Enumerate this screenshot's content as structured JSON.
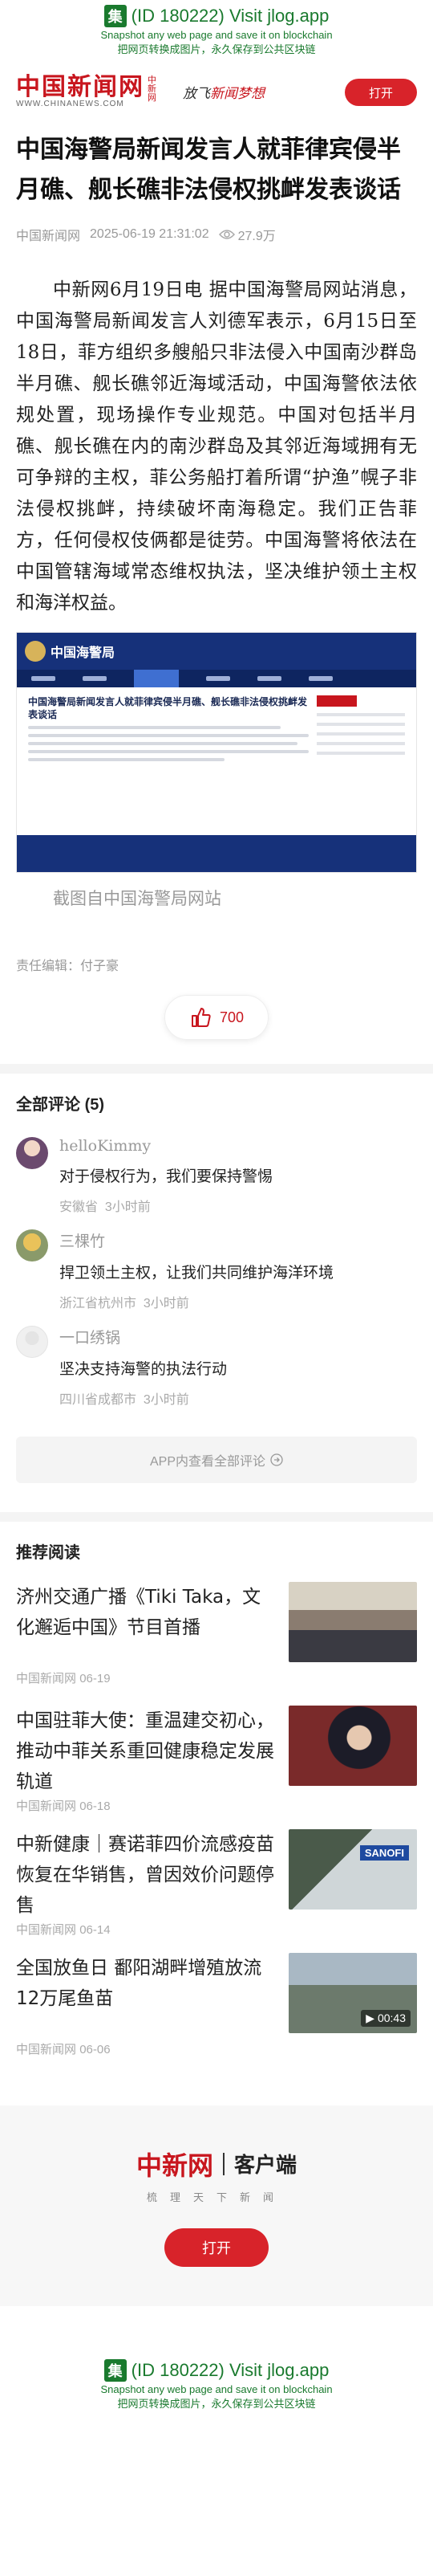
{
  "jlog": {
    "logo_char": "集",
    "title": "(ID 180222) Visit jlog.app",
    "sub1": "Snapshot any web page and save it on blockchain",
    "sub2": "把网页转换成图片，永久保存到公共区块链"
  },
  "header": {
    "brand_cn": "中国新闻网",
    "brand_en": "WWW.CHINANEWS.COM",
    "brand_side": "中新网",
    "slogan_a": "放飞",
    "slogan_b": "新闻",
    "slogan_c": "梦想",
    "open_label": "打开"
  },
  "article": {
    "title": "中国海警局新闻发言人就菲律宾侵半月礁、舰长礁非法侵权挑衅发表谈话",
    "source": "中国新闻网",
    "time": "2025-06-19 21:31:02",
    "views": "27.9万",
    "body": "中新网6月19日电 据中国海警局网站消息，中国海警局新闻发言人刘德军表示，6月15日至18日，菲方组织多艘船只非法侵入中国南沙群岛半月礁、舰长礁邻近海域活动，中国海警依法依规处置，现场操作专业规范。中国对包括半月礁、舰长礁在内的南沙群岛及其邻近海域拥有无可争辩的主权，菲公务船打着所谓“护渔”幌子非法侵权挑衅，持续破坏南海稳定。我们正告菲方，任何侵权伎俩都是徒劳。中国海警将依法在中国管辖海域常态维权执法，坚决维护领土主权和海洋权益。",
    "figure_site": "中国海警局",
    "figure_headline": "中国海警局新闻发言人就菲律宾侵半月礁、舰长礁非法侵权挑衅发表谈话",
    "caption": "截图自中国海警局网站",
    "editor": "责任编辑：付子豪",
    "likes": "700"
  },
  "comments": {
    "title": "全部评论",
    "count": "(5)",
    "items": [
      {
        "name": "helloKimmy",
        "text": "对于侵权行为，我们要保持警惕",
        "location": "安徽省",
        "time": "3小时前"
      },
      {
        "name": "三棵竹",
        "text": "捍卫领土主权，让我们共同维护海洋环境",
        "location": "浙江省杭州市",
        "time": "3小时前"
      },
      {
        "name": "一口绣锅",
        "text": "坚决支持海警的执法行动",
        "location": "四川省成都市",
        "time": "3小时前"
      }
    ],
    "more": "APP内查看全部评论"
  },
  "recommend": {
    "title": "推荐阅读",
    "items": [
      {
        "title": "济州交通广播《Tiki Taka，文化邂逅中国》节目首播",
        "source": "中国新闻网",
        "date": "06-19"
      },
      {
        "title": "中国驻菲大使：重温建交初心，推动中菲关系重回健康稳定发展轨道",
        "source": "中国新闻网",
        "date": "06-18"
      },
      {
        "title": "中新健康｜赛诺菲四价流感疫苗恢复在华销售，曾因效价问题停售",
        "source": "中国新闻网",
        "date": "06-14"
      },
      {
        "title": "全国放鱼日 鄱阳湖畔增殖放流12万尾鱼苗",
        "source": "中国新闻网",
        "date": "06-06",
        "duration": "00:43"
      }
    ]
  },
  "client": {
    "logo": "中新网",
    "label": "客户端",
    "motto": "梳理天下新闻",
    "open_label": "打开"
  },
  "colors": {
    "brand_red": "#d8232a",
    "jlog_green": "#1a7a2e"
  }
}
